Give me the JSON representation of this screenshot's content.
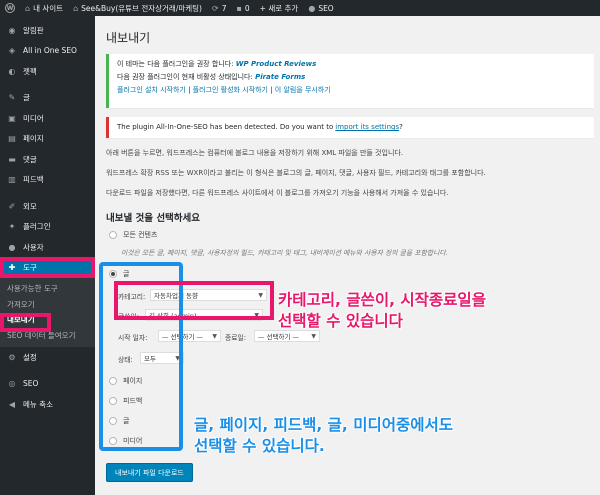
{
  "adminbar": {
    "site_name": "내 사이트",
    "site_title": "See&Buy(유튜브 전자상거래/마케팅)",
    "updates_count": "7",
    "comments_count": "0",
    "new_label": "+ 새로 추가",
    "seo_label": "SEO"
  },
  "sidebar": {
    "items": [
      {
        "label": "알림판",
        "icon": "dashboard-icon"
      },
      {
        "label": "All in One SEO",
        "icon": "seo-icon"
      },
      {
        "label": "젯팩",
        "icon": "jetpack-icon"
      },
      {
        "label": "글",
        "icon": "pin-icon"
      },
      {
        "label": "미디어",
        "icon": "media-icon"
      },
      {
        "label": "페이지",
        "icon": "page-icon"
      },
      {
        "label": "댓글",
        "icon": "comment-icon"
      },
      {
        "label": "피드백",
        "icon": "feedback-icon"
      },
      {
        "label": "외모",
        "icon": "brush-icon"
      },
      {
        "label": "플러그인",
        "icon": "plugin-icon"
      },
      {
        "label": "사용자",
        "icon": "user-icon"
      },
      {
        "label": "도구",
        "icon": "wrench-icon"
      },
      {
        "label": "설정",
        "icon": "settings-icon"
      },
      {
        "label": "SEO",
        "icon": "yoast-icon"
      },
      {
        "label": "메뉴 축소",
        "icon": "collapse-icon"
      }
    ],
    "submenu": [
      "사용가능한 도구",
      "가져오기",
      "내보내기",
      "SEO 데이터 들여오기"
    ]
  },
  "page": {
    "title": "내보내기",
    "notice_line1_prefix": "이 테마는 다음 플러그인을 권장 합니다: ",
    "notice_line1_plugin": "WP Product Reviews",
    "notice_line2_prefix": "다음 권장 플러그인이 현재 비활성 상태입니다: ",
    "notice_line2_plugin": "Pirate Forms",
    "notice_link1": "플러그인 설치 시작하기",
    "notice_link2": "플러그인 활성화 시작하기",
    "notice_link3": "이 알림을 무시하기",
    "seo_notice_prefix": "The plugin All-In-One-SEO has been detected. Do you want to ",
    "seo_notice_link": "import its settings",
    "seo_notice_suffix": "?",
    "para1": "아래 버튼을 누르면, 워드프레스는 컴퓨터에 블로그 내용을 저장하기 위해 XML 파일을 만들 것입니다.",
    "para2": "워드프레스 확장 RSS 또는 WXR이라고 불리는 이 형식은 블로그의 글, 페이지, 댓글, 사용자 필드, 카테고리와 태그를 포함합니다.",
    "para3": "다운로드 파일을 저장했다면, 다른 워드프레스 사이트에서 이 블로그를 가져오기 기능을 사용해서 가져올 수 있습니다.",
    "choose_heading": "내보낼 것을 선택하세요",
    "opt_all": "모든 컨텐츠",
    "opt_all_desc": "이것은 모든 글, 페이지, 댓글, 사용자정의 필드, 카테고리 및 태그, 내비게이션 메뉴와 사용자 정의 글을 포함합니다.",
    "opt_posts": "글",
    "category_label": "카테고리:",
    "category_value": "자동차업계 동향",
    "author_label": "글쓴이:",
    "author_value": "김 상희 (admin)",
    "start_label": "시작 일자:",
    "start_value": "— 선택하기 —",
    "end_label": "종료일:",
    "end_value": "— 선택하기 —",
    "status_label": "상태:",
    "status_value": "모두",
    "opt_pages": "페이지",
    "opt_feedback": "피드백",
    "opt_posts2": "글",
    "opt_media": "미디어",
    "download_button": "내보내기 파일 다운로드"
  },
  "annotations": {
    "pink_text_line1": "카테고리, 글쓴이, 시작종료일을",
    "pink_text_line2": "선택할 수 있습니다",
    "blue_text_line1": "글, 페이지, 피드백, 글, 미디어중에서도",
    "blue_text_line2": "선택할 수 있습니다.",
    "pink_color": "#e8176b",
    "blue_color": "#1a8fe8"
  }
}
